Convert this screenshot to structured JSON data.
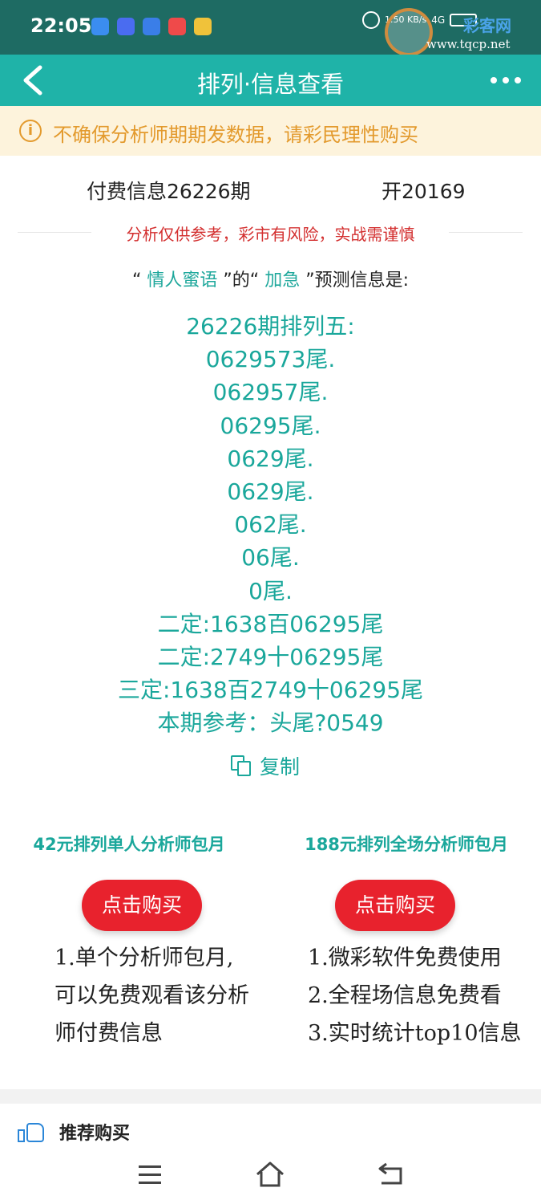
{
  "status_bar": {
    "time": "22:05",
    "speed": "1.50 KB/s",
    "signal": "4G",
    "watermark_site": "彩客网",
    "watermark_url": "www.tqcp.net"
  },
  "nav": {
    "title": "排列·信息查看",
    "back_icon": "chevron-left-icon",
    "more_icon": "more-dots-icon"
  },
  "notice": {
    "icon": "info-circle-icon",
    "text": "不确保分析师期期发数据，请彩民理性购买"
  },
  "info": {
    "title": "付费信息26226期",
    "open": "开20169",
    "warning": "分析仅供参考，彩市有风险，实战需谨慎"
  },
  "prediction": {
    "quote_open": "“",
    "analyst": "情人蜜语",
    "quote_close_de": "”的“",
    "category": "加急",
    "suffix": "”预测信息是:"
  },
  "results": [
    "26226期排列五:",
    "0629573尾.",
    "062957尾.",
    "06295尾.",
    "0629尾.",
    "0629尾.",
    "062尾.",
    "06尾.",
    "0尾.",
    "二定:1638百06295尾",
    "二定:2749十06295尾",
    "三定:1638百2749十06295尾",
    "本期参考：头尾?0549"
  ],
  "copy": {
    "label": "复制",
    "icon": "copy-icon"
  },
  "plans": [
    {
      "title": "42元排列单人分析师包月",
      "button": "点击购买",
      "desc": [
        "1.单个分析师包月,",
        "可以免费观看该分析",
        "师付费信息"
      ]
    },
    {
      "title": "188元排列全场分析师包月",
      "button": "点击购买",
      "desc": [
        "1.微彩软件免费使用",
        "2.全程场信息免费看",
        "3.实时统计top10信息"
      ]
    }
  ],
  "recommend": {
    "icon": "thumbs-up-icon",
    "label": "推荐购买"
  },
  "colors": {
    "status_bar": "#1e6b63",
    "nav_bar": "#1fb3a8",
    "accent_teal": "#1aa79b",
    "notice_bg": "#fdf3dc",
    "notice_text": "#e39a2d",
    "warning_red": "#d32f2f",
    "buy_button": "#e8222d"
  }
}
